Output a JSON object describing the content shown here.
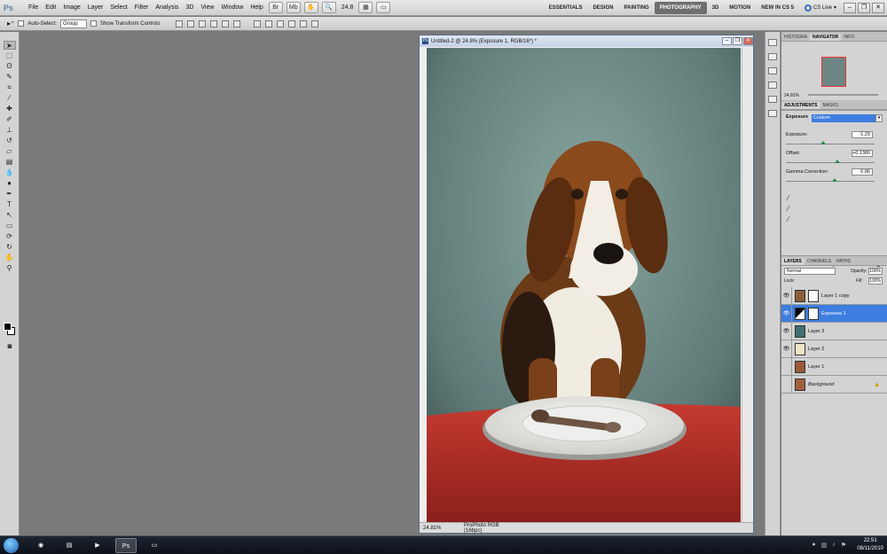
{
  "app": {
    "logo": "Ps",
    "menu": [
      "File",
      "Edit",
      "Image",
      "Layer",
      "Select",
      "Filter",
      "Analysis",
      "3D",
      "View",
      "Window",
      "Help"
    ],
    "zoom_display": "24.8",
    "workspaces": [
      "ESSENTIALS",
      "DESIGN",
      "PAINTING",
      "PHOTOGRAPHY",
      "3D",
      "MOTION",
      "NEW IN CS 5"
    ],
    "active_workspace": "PHOTOGRAPHY",
    "cs_live": "CS Live"
  },
  "options_bar": {
    "auto_select_label": "Auto-Select:",
    "auto_select_value": "Group",
    "transform_label": "Show Transform Controls"
  },
  "document": {
    "title": "Untitled-2 @ 24.8% (Exposure 1, RGB/16*) *",
    "status_zoom": "24.81%",
    "status_profile": "ProPhoto RGB (16bpc)"
  },
  "navigator": {
    "tabs": [
      "HISTOGRA",
      "NAVIGATOR",
      "INFO"
    ],
    "active_tab": "NAVIGATOR",
    "zoom": "24.81%"
  },
  "adjustments": {
    "tabs": [
      "ADJUSTMENTS",
      "MASKS"
    ],
    "active_tab": "ADJUSTMENTS",
    "adjustment_name": "Exposure",
    "preset": "Custom",
    "exposure_label": "Exposure:",
    "exposure_value": "-1.29",
    "exposure_level": 0.42,
    "offset_label": "Offset:",
    "offset_value": "+0.1386",
    "offset_level": 0.58,
    "gamma_label": "Gamma Correction:",
    "gamma_value": "0.86",
    "gamma_level": 0.55
  },
  "layers_panel": {
    "tabs": [
      "LAYERS",
      "CHANNELS",
      "PATHS"
    ],
    "active_tab": "LAYERS",
    "blend_mode": "Normal",
    "opacity_label": "Opacity:",
    "opacity": "100%",
    "lock_label": "Lock:",
    "fill_label": "Fill:",
    "fill": "100%",
    "layers": [
      {
        "name": "Layer 1 copy",
        "visible": true,
        "mask": true,
        "active": false
      },
      {
        "name": "Exposure 1",
        "visible": true,
        "mask": true,
        "active": true
      },
      {
        "name": "Layer 3",
        "visible": true,
        "mask": false,
        "active": false
      },
      {
        "name": "Layer 2",
        "visible": true,
        "mask": false,
        "active": false
      },
      {
        "name": "Layer 1",
        "visible": false,
        "mask": false,
        "active": false
      },
      {
        "name": "Background",
        "visible": false,
        "mask": false,
        "active": false,
        "locked": true
      }
    ]
  },
  "taskbar": {
    "apps": [
      "chrome",
      "explorer",
      "media-player",
      "Ps",
      "window"
    ],
    "active_app": "Ps",
    "time": "22:51",
    "date": "08/11/2010"
  },
  "colors": {
    "accent": "#3d7ee0",
    "backdrop": "#6f8d88",
    "tablecloth": "#b0302a"
  }
}
